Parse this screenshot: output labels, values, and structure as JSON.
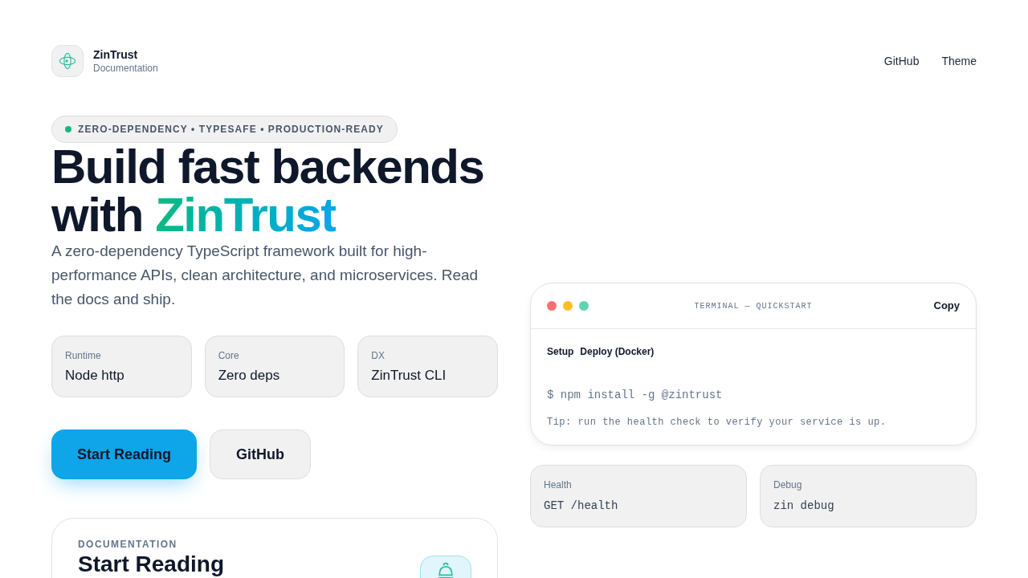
{
  "header": {
    "brand_title": "ZinTrust",
    "brand_subtitle": "Documentation",
    "nav": [
      "GitHub",
      "Theme"
    ]
  },
  "hero": {
    "badge": "ZERO-DEPENDENCY • TYPESAFE • PRODUCTION-READY",
    "title_line_1": "Build fast backends",
    "title_line_2": "with",
    "title_highlight": "ZinTrust",
    "description": "A zero-dependency TypeScript framework built for high-performance APIs, clean architecture, and microservices. Read the docs and ship.",
    "stats": [
      {
        "label": "Runtime",
        "value": "Node http"
      },
      {
        "label": "Core",
        "value": "Zero deps"
      },
      {
        "label": "DX",
        "value": "ZinTrust CLI"
      }
    ],
    "buttons": [
      {
        "label": "Start Reading",
        "kind": "primary"
      },
      {
        "label": "GitHub",
        "kind": "secondary"
      }
    ]
  },
  "doc_card": {
    "eyebrow": "DOCUMENTATION",
    "title": "Start Reading"
  },
  "terminal": {
    "dots": [
      {
        "color": "#f87171"
      },
      {
        "color": "#fbbf24"
      },
      {
        "color": "#5fd4b0"
      }
    ],
    "title": "TERMINAL — QUICKSTART",
    "copy": "Copy",
    "tabs": [
      "Setup",
      "Deploy (Docker)"
    ],
    "command": "$ npm install -g @zintrust",
    "tip": "Tip: run the health check to verify your service is up."
  },
  "shortcuts": [
    {
      "label": "Health",
      "value": "GET /health"
    },
    {
      "label": "Debug",
      "value": "zin debug"
    }
  ]
}
